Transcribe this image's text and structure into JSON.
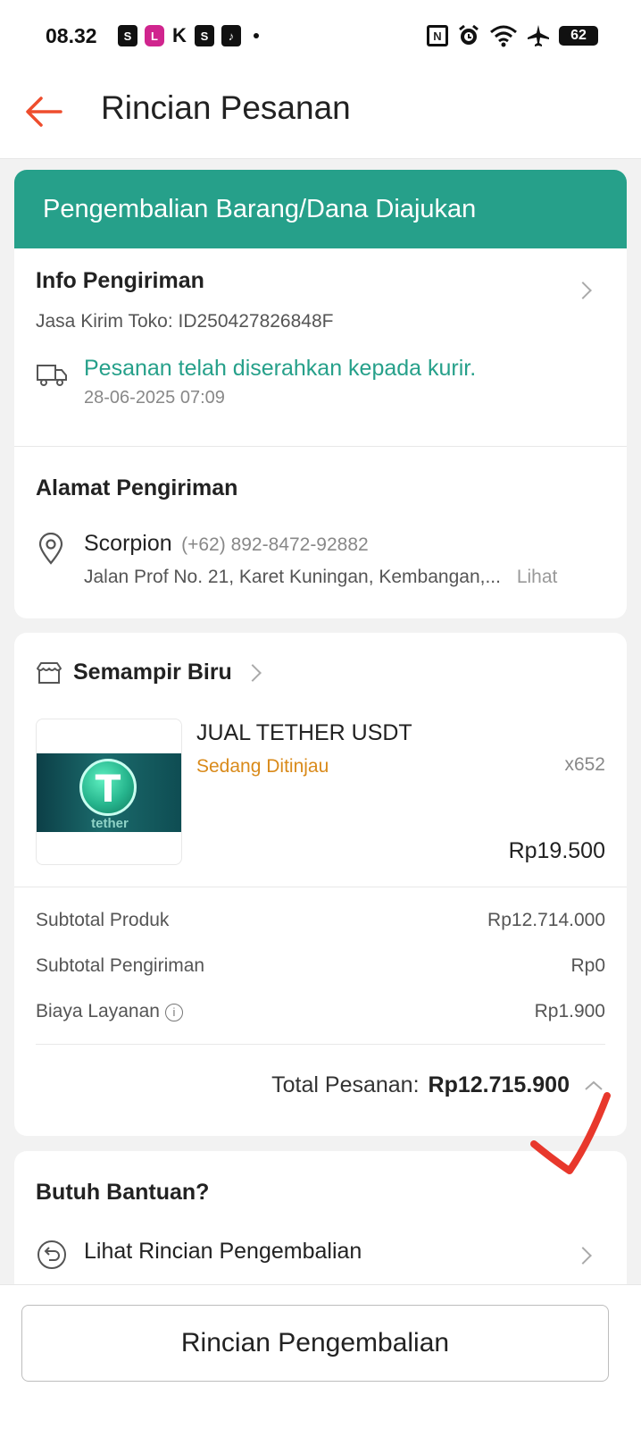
{
  "status_bar": {
    "time": "08.32",
    "battery": "62"
  },
  "header": {
    "title": "Rincian Pesanan"
  },
  "status_banner": "Pengembalian Barang/Dana Diajukan",
  "shipping_info": {
    "title": "Info Pengiriman",
    "courier": "Jasa Kirim Toko: ID250427826848F",
    "status": "Pesanan telah diserahkan kepada kurir.",
    "date": "28-06-2025 07:09"
  },
  "address": {
    "title": "Alamat Pengiriman",
    "name": "Scorpion",
    "phone": "(+62) 892-8472-92882",
    "line": "Jalan Prof No. 21, Karet Kuningan, Kembangan,...",
    "see_more": "Lihat"
  },
  "order": {
    "store_name": "Semampir Biru",
    "product_name": "JUAL TETHER USDT",
    "product_status": "Sedang Ditinjau",
    "quantity": "x652",
    "unit_price": "Rp19.500",
    "thumb_label": "tether",
    "summary": [
      {
        "label": "Subtotal Produk",
        "value": "Rp12.714.000"
      },
      {
        "label": "Subtotal Pengiriman",
        "value": "Rp0"
      },
      {
        "label": "Biaya Layanan",
        "value": "Rp1.900"
      }
    ],
    "total_label": "Total Pesanan:",
    "total_value": "Rp12.715.900"
  },
  "help": {
    "title": "Butuh Bantuan?",
    "item": "Lihat Rincian Pengembalian"
  },
  "bottom_button": "Rincian Pengembalian",
  "colors": {
    "accent_green": "#26a08a",
    "brand_orange": "#ee4d2d",
    "pending_orange": "#d98a1a",
    "annotation_red": "#e8382c"
  }
}
